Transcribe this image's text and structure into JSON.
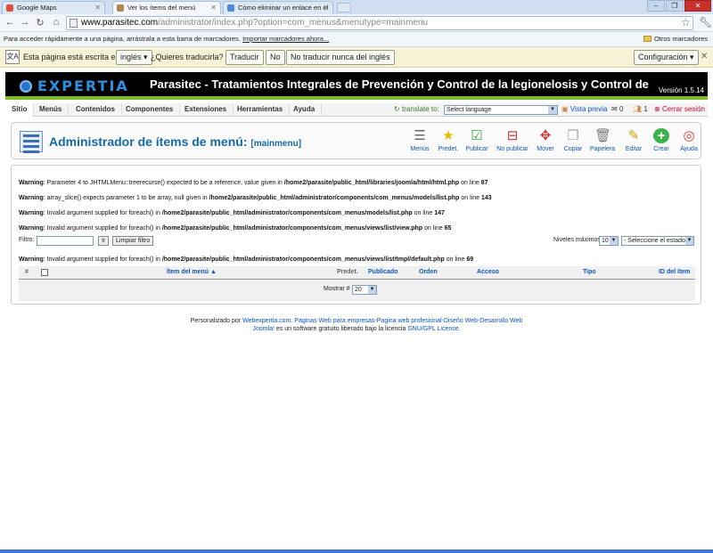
{
  "browser": {
    "tabs": [
      {
        "title": "Google Maps",
        "color": "#e04b3b"
      },
      {
        "title": "Ver los ítems del menú",
        "color": "#b0874c"
      },
      {
        "title": "Cómo eliminar un enlace en el",
        "color": "#4a8bd6"
      }
    ],
    "url_host": "www.parasitec.com",
    "url_path": "/administrator/index.php?option=com_menus&menutype=mainmenu",
    "bookmarks_text": "Para acceder rápidamente a una página, arrástrala a esta barra de marcadores.",
    "bookmarks_import": "Importar marcadores ahora...",
    "other_bookmarks": "Otros marcadores"
  },
  "translate": {
    "prefix": "Esta página está escrita en",
    "language": "inglés",
    "question": "¿Quieres traducirla?",
    "translate_btn": "Traducir",
    "no_btn": "No",
    "never_btn": "No traducir nunca del inglés",
    "options_btn": "Configuración"
  },
  "site": {
    "logo_text": "EXPERTIA",
    "title": "Parasitec - Tratamientos Integrales de Prevención y Control de la legionelosis y Control de",
    "version": "Versión 1.5.14"
  },
  "menu": {
    "items": [
      "Sitio",
      "Menús",
      "Contenidos",
      "Componentes",
      "Extensiones",
      "Herramientas",
      "Ayuda"
    ],
    "translate_to": "translate to:",
    "language_select": "Select language",
    "preview": "Vista previa",
    "messages": "0",
    "users": "1",
    "logout": "Cerrar sesión"
  },
  "toolbar": {
    "title": "Administrador de ítems de menú:",
    "subtitle": "[mainmenu]",
    "buttons": [
      "Menús",
      "Predet.",
      "Publicar",
      "No publicar",
      "Mover",
      "Copiar",
      "Papelera",
      "Editar",
      "Crear",
      "Ayuda"
    ]
  },
  "warnings": [
    {
      "label": "Warning",
      "msg": ": Parameter 4 to JHTMLMenu::treerecurse() expected to be a reference, value given in ",
      "file": "/home2/parasite/public_html/libraries/joomla/html/html.php",
      "mid": " on line ",
      "line": "87"
    },
    {
      "label": "Warning",
      "msg": ": array_slice() expects parameter 1 to be array, null given in ",
      "file": "/home2/parasite/public_html/administrator/components/com_menus/models/list.php",
      "mid": " on line ",
      "line": "143"
    },
    {
      "label": "Warning",
      "msg": ": Invalid argument supplied for foreach() in ",
      "file": "/home2/parasite/public_html/administrator/components/com_menus/models/list.php",
      "mid": " on line ",
      "line": "147"
    },
    {
      "label": "Warning",
      "msg": ": Invalid argument supplied for foreach() in ",
      "file": "/home2/parasite/public_html/administrator/components/com_menus/views/list/view.php",
      "mid": " on line ",
      "line": "65"
    },
    {
      "label": "Warning",
      "msg": ": Invalid argument supplied for foreach() in ",
      "file": "/home2/parasite/public_html/administrator/components/com_menus/views/list/tmpl/default.php",
      "mid": " on line ",
      "line": "69"
    }
  ],
  "filter": {
    "label": "Filtro:",
    "value": "",
    "go_btn": "Ir",
    "reset_btn": "Limpiar filtro",
    "levels_label": "Niveles máximos",
    "levels_value": "10",
    "state_value": "- Seleccione el estado -"
  },
  "table": {
    "columns": [
      "#",
      "Ítem del menú",
      "Predet.",
      "Publicado",
      "Orden",
      "Acceso",
      "Tipo",
      "ID del ítem"
    ],
    "show_label": "Mostrar #",
    "show_value": "20"
  },
  "footer": {
    "line1_pre": "Personalizado por ",
    "line1_link": "Webexpertia.com. Paginas Web para empresas-Pagina web profesional-Diseño Web-Desarrollo Web",
    "line2_link1": "Joomla!",
    "line2_mid": " es un software gratuito liberado bajo la licencia ",
    "line2_link2": "GNU/GPL License."
  }
}
